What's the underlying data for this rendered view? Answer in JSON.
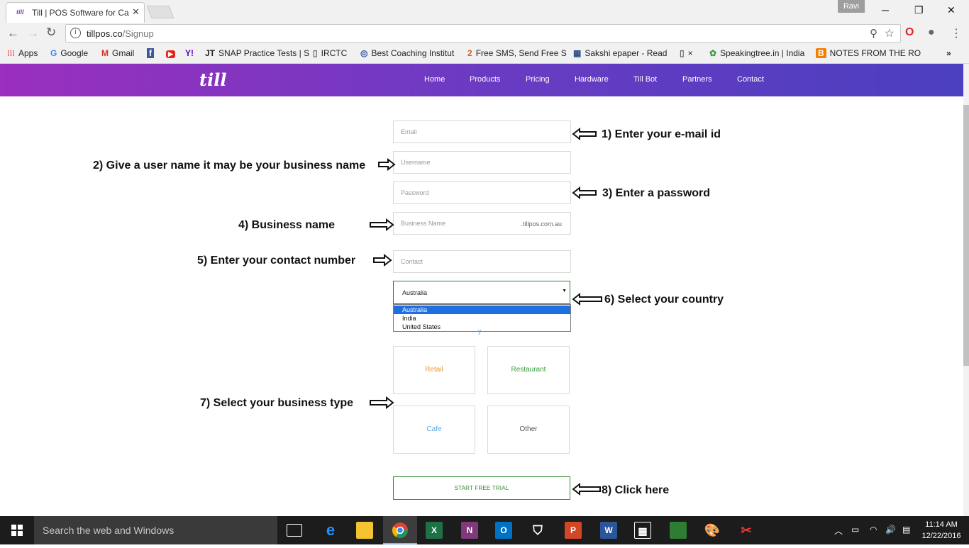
{
  "browser": {
    "tab_title": "Till | POS Software for Ca",
    "tab_favicon": "till",
    "user_badge": "Ravi",
    "url_host": "tillpos.co",
    "url_path": "/Signup",
    "info_icon": "i"
  },
  "bookmarks": [
    {
      "label": "Apps",
      "icon": "apps-icon"
    },
    {
      "label": "Google",
      "icon": "google-icon"
    },
    {
      "label": "Gmail",
      "icon": "gmail-icon"
    },
    {
      "label": "",
      "icon": "facebook-icon"
    },
    {
      "label": "",
      "icon": "youtube-icon"
    },
    {
      "label": "",
      "icon": "yahoo-icon"
    },
    {
      "label": "SNAP Practice Tests | S",
      "icon": "jt-icon"
    },
    {
      "label": "IRCTC",
      "icon": "page-icon"
    },
    {
      "label": "Best Coaching Institut",
      "icon": "globe-icon"
    },
    {
      "label": "Free SMS, Send Free S",
      "icon": "sms-icon"
    },
    {
      "label": "Sakshi epaper - Read",
      "icon": "grid-icon"
    },
    {
      "label": "×",
      "icon": "page-icon"
    },
    {
      "label": "Speakingtree.in | India",
      "icon": "tree-icon"
    },
    {
      "label": "NOTES FROM THE RO",
      "icon": "blogger-icon"
    }
  ],
  "site": {
    "logo": "till",
    "nav": [
      "Home",
      "Products",
      "Pricing",
      "Hardware",
      "Till Bot",
      "Partners",
      "Contact"
    ]
  },
  "form": {
    "email_placeholder": "Email",
    "username_placeholder": "Username",
    "password_placeholder": "Password",
    "business_placeholder": "Business Name",
    "business_suffix": ".tillpos.com.au",
    "contact_placeholder": "Contact",
    "country_selected": "Australia",
    "country_options": [
      "Australia",
      "India",
      "United States"
    ],
    "hidden_text": "y",
    "business_types": [
      "Retail",
      "Restaurant",
      "Cafe",
      "Other"
    ],
    "cta": "START FREE TRIAL"
  },
  "annotations": {
    "n1": "1) Enter your e-mail id",
    "n2": "2) Give a user name it may be your business name",
    "n3": "3) Enter a password",
    "n4": "4) Business name",
    "n5": "5) Enter your contact number",
    "n6": "6) Select your country",
    "n7": "7) Select your business type",
    "n8": "8) Click here"
  },
  "taskbar": {
    "search_placeholder": "Search the web and Windows",
    "time": "11:14 AM",
    "date": "12/22/2016"
  },
  "colors": {
    "nav_gradient_start": "#9b2fbf",
    "nav_gradient_end": "#4b3fc0",
    "retail": "#e8943a",
    "restaurant": "#3a9a3a",
    "cafe": "#5aa8e0",
    "other": "#555555",
    "cta_green": "#2e8b2e"
  }
}
